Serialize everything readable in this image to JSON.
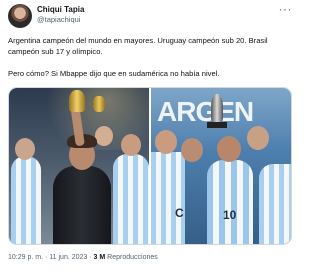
{
  "tweet": {
    "author": {
      "display_name": "Chiqui Tapia",
      "handle": "@tapiachiqui"
    },
    "more_icon": "more-dots-icon",
    "text_line1": "Argentina campeón del mundo en mayores. Uruguay campeón sub 20. Brasil campeón sub 17 y olímpico.",
    "text_line2": "Pero cómo? Si Mbappe dijo que en sudamérica no había nivel.",
    "media": {
      "banner_text": "ARGEN",
      "jersey_letter": "C",
      "jersey_number": "10"
    },
    "meta": {
      "time": "10:29 p. m.",
      "separator": "·",
      "date": "11 jun. 2023",
      "views_count": "3 M",
      "views_label": "Reproducciones"
    }
  }
}
